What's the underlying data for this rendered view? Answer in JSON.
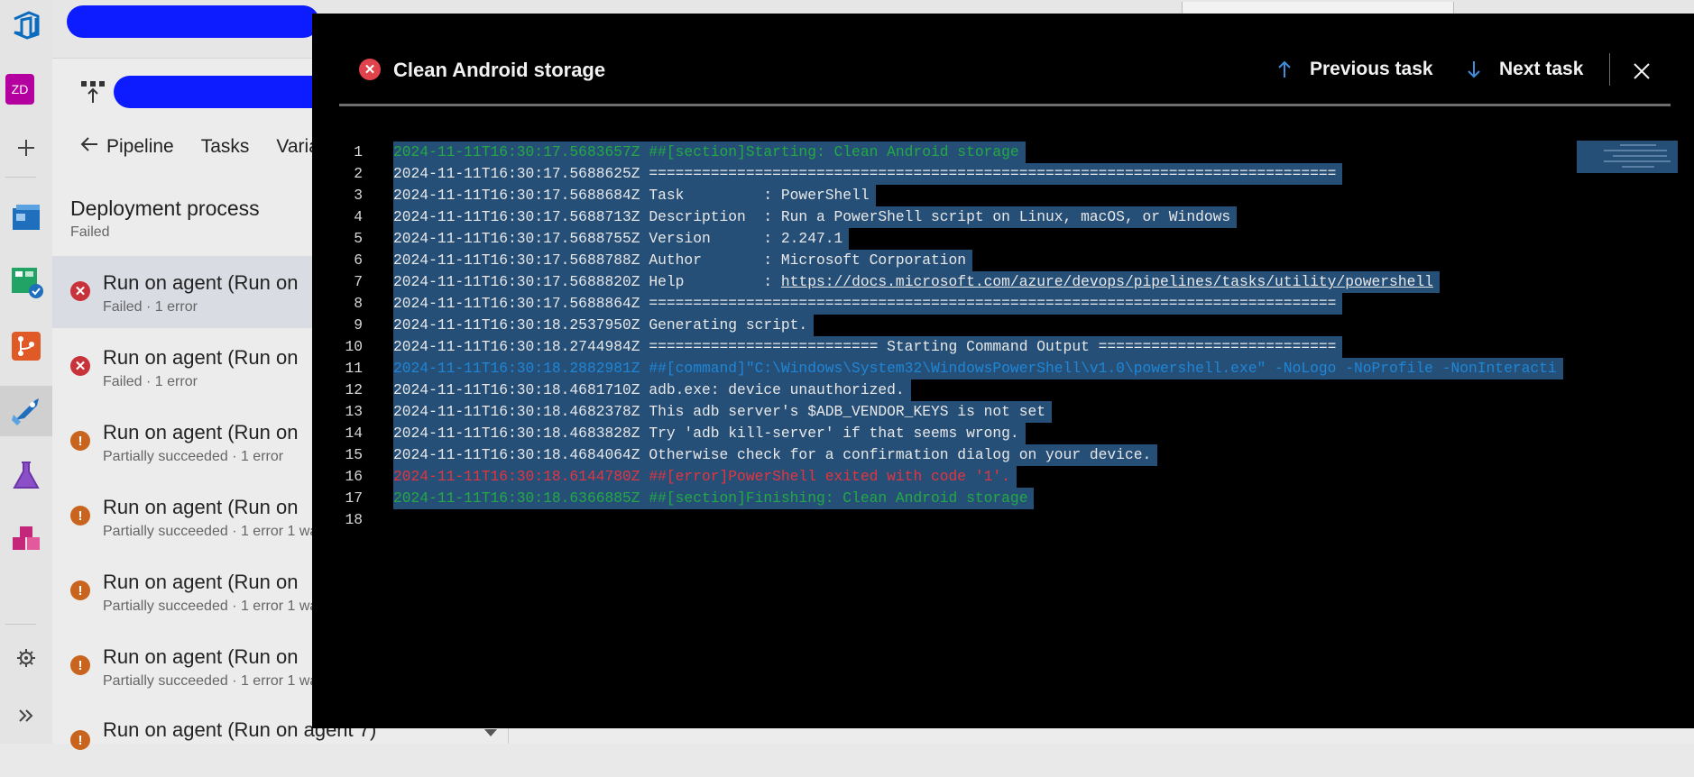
{
  "page": {
    "deployment_title": "Deployment process",
    "deployment_status": "Failed",
    "tabs": [
      "Pipeline",
      "Tasks",
      "Varia"
    ],
    "user_initials": "ZD",
    "agents": [
      {
        "title": "Run on agent (Run on",
        "status": "Failed · 1 error",
        "state": "error"
      },
      {
        "title": "Run on agent (Run on",
        "status": "Failed · 1 error",
        "state": "error"
      },
      {
        "title": "Run on agent (Run on",
        "status": "Partially succeeded · 1 error",
        "state": "warning"
      },
      {
        "title": "Run on agent (Run on",
        "status": "Partially succeeded · 1 error 1 wa",
        "state": "warning"
      },
      {
        "title": "Run on agent (Run on",
        "status": "Partially succeeded · 1 error 1 wa",
        "state": "warning"
      },
      {
        "title": "Run on agent (Run on",
        "status": "Partially succeeded · 1 error 1 wa",
        "state": "warning"
      },
      {
        "title": "Run on agent (Run on agent 7)",
        "status": "",
        "state": "warning"
      }
    ]
  },
  "modal": {
    "task_title": "Clean Android storage",
    "task_status": "failed",
    "previous_label": "Previous task",
    "next_label": "Next task"
  },
  "log_lines": [
    {
      "n": "1",
      "text": "2024-11-11T16:30:17.5683657Z ##[section]Starting: Clean Android storage",
      "style": "green"
    },
    {
      "n": "2",
      "text": "2024-11-11T16:30:17.5688625Z ==============================================================================",
      "style": "normal"
    },
    {
      "n": "3",
      "text": "2024-11-11T16:30:17.5688684Z Task         : PowerShell",
      "style": "normal"
    },
    {
      "n": "4",
      "text": "2024-11-11T16:30:17.5688713Z Description  : Run a PowerShell script on Linux, macOS, or Windows",
      "style": "normal"
    },
    {
      "n": "5",
      "text": "2024-11-11T16:30:17.5688755Z Version      : 2.247.1",
      "style": "normal"
    },
    {
      "n": "6",
      "text": "2024-11-11T16:30:17.5688788Z Author       : Microsoft Corporation",
      "style": "normal"
    },
    {
      "n": "7",
      "prefix": "2024-11-11T16:30:17.5688820Z Help         : ",
      "link": "https://docs.microsoft.com/azure/devops/pipelines/tasks/utility/powershell",
      "style": "normal"
    },
    {
      "n": "8",
      "text": "2024-11-11T16:30:17.5688864Z ==============================================================================",
      "style": "normal"
    },
    {
      "n": "9",
      "text": "2024-11-11T16:30:18.2537950Z Generating script.",
      "style": "normal"
    },
    {
      "n": "10",
      "text": "2024-11-11T16:30:18.2744984Z ========================== Starting Command Output ===========================",
      "style": "normal"
    },
    {
      "n": "11",
      "text": "2024-11-11T16:30:18.2882981Z ##[command]\"C:\\Windows\\System32\\WindowsPowerShell\\v1.0\\powershell.exe\" -NoLogo -NoProfile -NonInteracti",
      "style": "blue"
    },
    {
      "n": "12",
      "text": "2024-11-11T16:30:18.4681710Z adb.exe: device unauthorized.",
      "style": "normal"
    },
    {
      "n": "13",
      "text": "2024-11-11T16:30:18.4682378Z This adb server's $ADB_VENDOR_KEYS is not set",
      "style": "normal"
    },
    {
      "n": "14",
      "text": "2024-11-11T16:30:18.4683828Z Try 'adb kill-server' if that seems wrong.",
      "style": "normal"
    },
    {
      "n": "15",
      "text": "2024-11-11T16:30:18.4684064Z Otherwise check for a confirmation dialog on your device.",
      "style": "normal"
    },
    {
      "n": "16",
      "text": "2024-11-11T16:30:18.6144780Z ##[error]PowerShell exited with code '1'.",
      "style": "red"
    },
    {
      "n": "17",
      "text": "2024-11-11T16:30:18.6366885Z ##[section]Finishing: Clean Android storage",
      "style": "green"
    },
    {
      "n": "18",
      "text": "",
      "style": "normal"
    }
  ],
  "colors": {
    "modal_bg": "#000000",
    "selection": "#264f78",
    "section_green": "#23a943",
    "command_blue": "#1f86d6",
    "error_red": "#e5343f",
    "failed_icon": "#e0434b",
    "warning_icon": "#c8641e"
  },
  "icons": {
    "rail": [
      "azure-devops-logo-icon",
      "plus-icon",
      "boards-icon",
      "test-plans-icon",
      "repos-icon",
      "pipelines-icon",
      "test-beaker-icon",
      "artifacts-icon",
      "settings-gear-icon",
      "expand-chevrons-icon"
    ],
    "header": [
      "error-circle-icon",
      "arrow-up-icon",
      "arrow-down-icon",
      "close-icon"
    ]
  }
}
